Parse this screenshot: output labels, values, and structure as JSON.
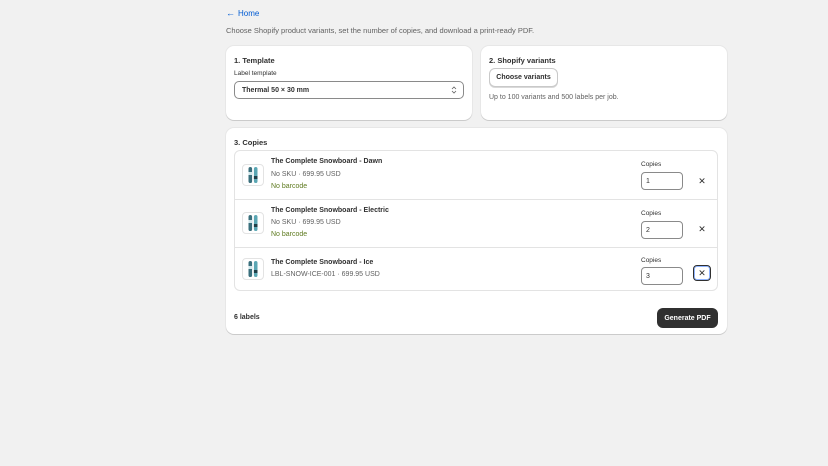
{
  "nav": {
    "back_label": "Home",
    "back_arrow": "←"
  },
  "page": {
    "subtitle": "Choose Shopify product variants, set the number of copies, and download a print-ready PDF."
  },
  "template_card": {
    "title": "1. Template",
    "field_label": "Label template",
    "selected_value": "Thermal 50 × 30 mm"
  },
  "variants_card": {
    "title": "2. Shopify variants",
    "button_label": "Choose variants",
    "hint": "Up to 100 variants and 500 labels per job."
  },
  "copies_card": {
    "title": "3. Copies",
    "copies_label": "Copies",
    "remove_icon": "✕",
    "items": [
      {
        "name": "The Complete Snowboard - Dawn",
        "meta": "No SKU · 699.95 USD",
        "warning": "No barcode",
        "copies": "1"
      },
      {
        "name": "The Complete Snowboard - Electric",
        "meta": "No SKU · 699.95 USD",
        "warning": "No barcode",
        "copies": "2"
      },
      {
        "name": "The Complete Snowboard - Ice",
        "meta": "LBL-SNOW-ICE-001 · 699.95 USD",
        "warning": "",
        "copies": "3"
      }
    ],
    "total": "6 labels",
    "generate_label": "Generate PDF"
  },
  "colors": {
    "accent_link": "#005bd3",
    "primary_button": "#303030",
    "warning_text": "#5e7a1f"
  }
}
